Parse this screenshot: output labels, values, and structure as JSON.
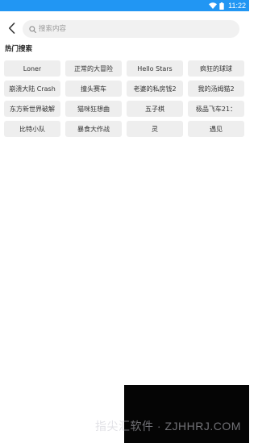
{
  "status_bar": {
    "time": "11:22",
    "icons": [
      "wifi-icon",
      "battery-icon"
    ],
    "background": "#2196f3"
  },
  "search": {
    "placeholder": "搜索内容",
    "value": ""
  },
  "hot_search": {
    "title": "热门搜索",
    "tags": [
      "Loner",
      "正常的大冒险",
      "Hello Stars",
      "疯狂的球球",
      "崩溃大陆 Crash",
      "撞头赛车",
      "老婆的私房钱2",
      "我的汤姆猫2",
      "东方新世界破解",
      "猫咪狂想曲",
      "五子棋",
      "极品飞车21：",
      "比特小队",
      "暴食大作战",
      "灵",
      "遇见"
    ]
  },
  "watermark": {
    "text": "指尖汇软件 · ZJHHRJ.COM"
  }
}
